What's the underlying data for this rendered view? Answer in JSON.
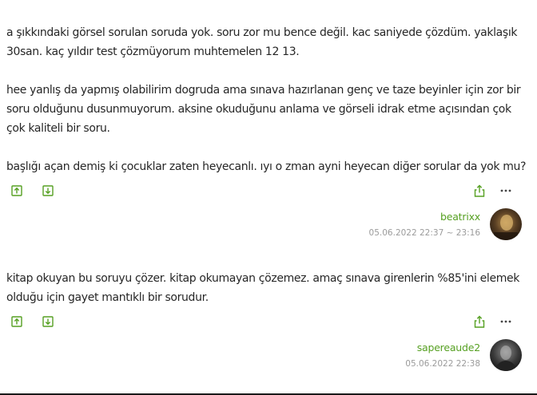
{
  "entries": [
    {
      "paragraphs": [
        [
          "a şıkkındaki görsel sorulan soruda yok. soru zor mu bence değil. kac saniyede çözdüm. yaklaşık",
          "30san. kaç yıldır test çözmüyorum muhtemelen 12 13."
        ],
        [
          "hee yanlış da yapmış olabilirim dogruda ama sınava hazırlanan genç ve taze beyinler için zor bir",
          "soru olduğunu dusunmuyorum. aksine okuduğunu anlama ve görseli idrak etme açısından çok",
          "çok kaliteli bir soru."
        ],
        [
          "başlığı açan demiş ki çocuklar zaten heyecanlı. ıyı o zman ayni heyecan diğer sorular da yok mu?"
        ]
      ],
      "author": "beatrixx",
      "date": "05.06.2022 22:37 ~ 23:16",
      "icons": {
        "upvote": "arrow-up-box-icon",
        "downvote": "arrow-down-box-icon",
        "share": "share-icon",
        "more": "more-dots-icon"
      }
    },
    {
      "paragraphs": [
        [
          "kitap okuyan bu soruyu çözer. kitap okumayan çözemez. amaç sınava girenlerin %85'ini elemek",
          "olduğu için gayet mantıklı bir sorudur."
        ]
      ],
      "author": "sapereaude2",
      "date": "05.06.2022 22:38",
      "icons": {
        "upvote": "arrow-up-box-icon",
        "downvote": "arrow-down-box-icon",
        "share": "share-icon",
        "more": "more-dots-icon"
      }
    }
  ],
  "colors": {
    "accent": "#56a022",
    "text": "#262626",
    "muted": "#9b9b9b"
  }
}
